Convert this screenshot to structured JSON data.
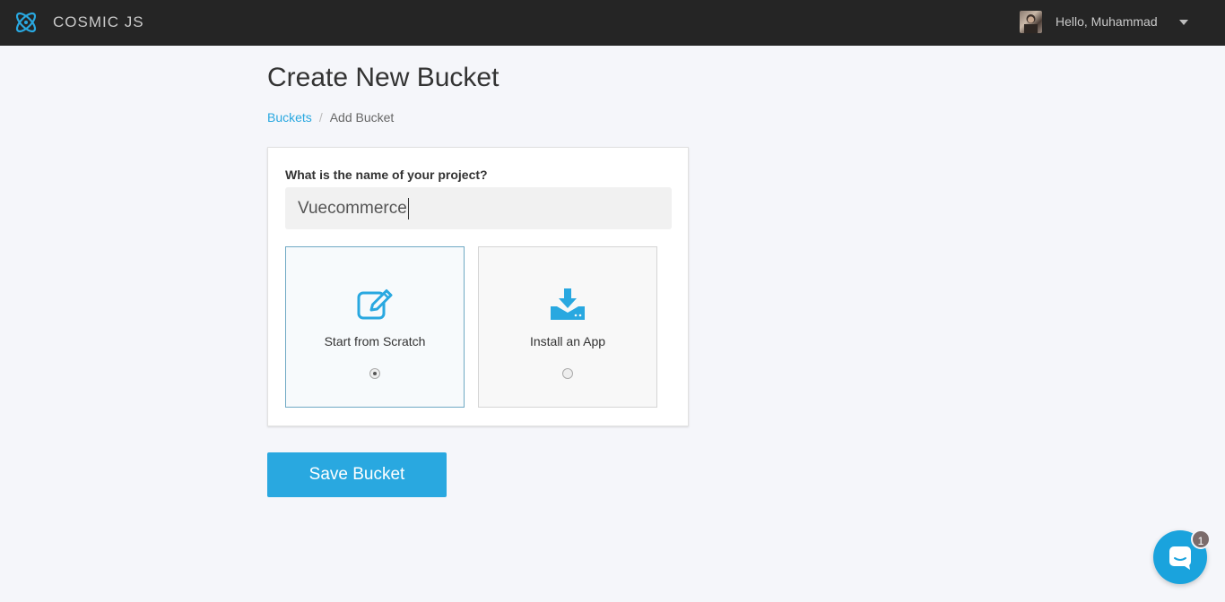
{
  "topbar": {
    "brand": "COSMIC JS",
    "logo_icon": "cosmic-atom-icon",
    "greeting": "Hello, Muhammad",
    "dropdown_icon": "caret-down-icon"
  },
  "page": {
    "title": "Create New Bucket",
    "breadcrumb": {
      "link": "Buckets",
      "separator": "/",
      "current": "Add Bucket"
    }
  },
  "form": {
    "question": "What is the name of your project?",
    "project_name": "Vuecommerce",
    "options": [
      {
        "label": "Start from Scratch",
        "icon": "edit-icon",
        "selected": true
      },
      {
        "label": "Install an App",
        "icon": "download-icon",
        "selected": false
      }
    ],
    "save_label": "Save Bucket"
  },
  "chat": {
    "icon": "chat-icon",
    "badge_count": "1"
  },
  "colors": {
    "accent": "#29a8e0",
    "topbar": "#252525",
    "background": "#f5f6fa"
  }
}
